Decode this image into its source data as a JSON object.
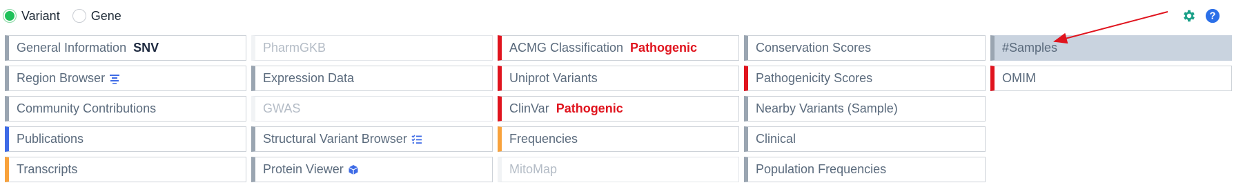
{
  "radios": {
    "variant_label": "Variant",
    "gene_label": "Gene",
    "selected": "Variant"
  },
  "icons": {
    "settings": "gear-icon",
    "help": "question-icon"
  },
  "colors": {
    "radio_selected": "#1fc15a",
    "default_bar": "#9aa5b1",
    "red_bar": "#e0141e",
    "orange_bar": "#f8a23c",
    "blue_bar": "#3e6be6",
    "highlight_bg": "#c9d3df",
    "gear": "#1aa088",
    "help": "#2b6fe8",
    "arrow": "#e0141e"
  },
  "panels": {
    "general_information": {
      "label": "General Information",
      "badge": "SNV"
    },
    "pharmgkb": {
      "label": "PharmGKB"
    },
    "acmg": {
      "label": "ACMG Classification",
      "badge": "Pathogenic"
    },
    "conservation_scores": {
      "label": "Conservation Scores"
    },
    "samples": {
      "label": "#Samples"
    },
    "region_browser": {
      "label": "Region Browser",
      "icon": "align-center-icon"
    },
    "expression_data": {
      "label": "Expression Data"
    },
    "uniprot_variants": {
      "label": "Uniprot Variants"
    },
    "pathogenicity_scores": {
      "label": "Pathogenicity Scores"
    },
    "omim": {
      "label": "OMIM"
    },
    "community_contributions": {
      "label": "Community Contributions"
    },
    "gwas": {
      "label": "GWAS"
    },
    "clinvar": {
      "label": "ClinVar",
      "badge": "Pathogenic"
    },
    "nearby_variants": {
      "label": "Nearby Variants (Sample)"
    },
    "publications": {
      "label": "Publications"
    },
    "structural_variant_browser": {
      "label": "Structural Variant Browser",
      "icon": "checklist-icon"
    },
    "frequencies": {
      "label": "Frequencies"
    },
    "clinical": {
      "label": "Clinical"
    },
    "transcripts": {
      "label": "Transcripts"
    },
    "protein_viewer": {
      "label": "Protein Viewer",
      "icon": "cube-icon"
    },
    "mitomap": {
      "label": "MitoMap"
    },
    "population_frequencies": {
      "label": "Population Frequencies"
    }
  }
}
